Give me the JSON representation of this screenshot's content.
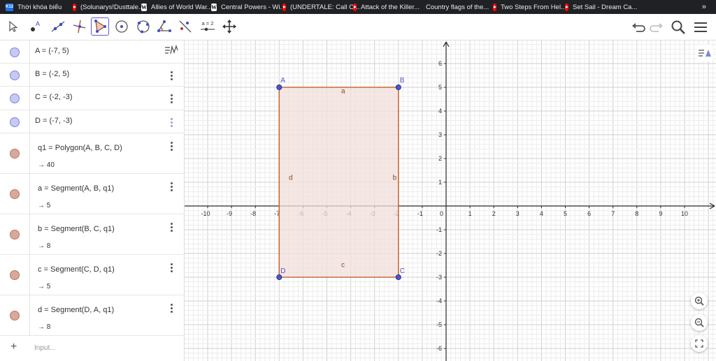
{
  "bookmarks": [
    {
      "icon": "k12",
      "label": "Thời khóa biểu"
    },
    {
      "icon": "yt",
      "label": "(Solunarys!Dusttale..."
    },
    {
      "icon": "wk",
      "label": "Allies of World War..."
    },
    {
      "icon": "wk",
      "label": "Central Powers - Wi..."
    },
    {
      "icon": "yt",
      "label": "(UNDERTALE: Call O..."
    },
    {
      "icon": "yt",
      "label": "Attack of the Killer..."
    },
    {
      "icon": "globe",
      "label": "Country flags of the..."
    },
    {
      "icon": "yt",
      "label": "Two Steps From Hel..."
    },
    {
      "icon": "yt",
      "label": "Set Sail - Dream Ca..."
    }
  ],
  "bookmarks_more": "»",
  "toolbar": {
    "slider_label": "a = 2",
    "tools": [
      "move-tool",
      "point-tool",
      "line-tool",
      "perpendicular-tool",
      "polygon-tool",
      "circle-center-tool",
      "circle-three-points-tool",
      "angle-tool",
      "reflect-tool",
      "slider-tool",
      "move-graphics-tool"
    ],
    "active_tool": "polygon-tool",
    "right": [
      "undo-icon",
      "redo-icon",
      "search-icon",
      "menu-icon"
    ]
  },
  "algebra": {
    "rows": [
      {
        "def": "A = (-7, 5)",
        "kind": "point"
      },
      {
        "def": "B = (-2, 5)",
        "kind": "point"
      },
      {
        "def": "C = (-2, -3)",
        "kind": "point"
      },
      {
        "def": "D = (-7, -3)",
        "kind": "point"
      },
      {
        "def": "q1 = Polygon(A, B, C, D)",
        "value": "→ 40",
        "kind": "segment"
      },
      {
        "def": "a = Segment(A, B, q1)",
        "value": "→ 5",
        "kind": "segment"
      },
      {
        "def": "b = Segment(B, C, q1)",
        "value": "→ 8",
        "kind": "segment"
      },
      {
        "def": "c = Segment(C, D, q1)",
        "value": "→ 5",
        "kind": "segment"
      },
      {
        "def": "d = Segment(D, A, q1)",
        "value": "→ 8",
        "kind": "segment"
      }
    ],
    "input_placeholder": "Input..."
  },
  "graph": {
    "x_ticks": [
      -10,
      -9,
      -8,
      -7,
      -6,
      -5,
      -4,
      -3,
      -2,
      -1,
      1,
      2,
      3,
      4,
      5,
      6,
      7,
      8,
      9,
      10
    ],
    "y_ticks": [
      -6,
      -5,
      -4,
      -3,
      -2,
      -1,
      1,
      2,
      3,
      4,
      5,
      6
    ],
    "origin_label": "0",
    "xlim": [
      -11.5,
      11.0
    ],
    "ylim": [
      -6.6,
      6.8
    ],
    "points": [
      {
        "name": "A",
        "x": -7,
        "y": 5
      },
      {
        "name": "B",
        "x": -2,
        "y": 5
      },
      {
        "name": "C",
        "x": -2,
        "y": -3
      },
      {
        "name": "D",
        "x": -7,
        "y": -3
      }
    ],
    "segment_labels": [
      {
        "name": "a",
        "x": -4.4,
        "y": 4.75
      },
      {
        "name": "b",
        "x": -2.24,
        "y": 1.1
      },
      {
        "name": "c",
        "x": -4.4,
        "y": -2.57
      },
      {
        "name": "d",
        "x": -6.6,
        "y": 1.1
      }
    ],
    "colors": {
      "polygon_fill": "#f2dfd9",
      "polygon_stroke": "#c66a3a",
      "point": "#4a56c8",
      "axis": "#2a2a2a",
      "grid_major": "#cfcfcf",
      "grid_minor": "#ececec",
      "tick_text": "#333333",
      "label_point": "#4a56c8",
      "label_segment": "#8a4b2b"
    }
  },
  "view_buttons": [
    "zoom-in-icon",
    "zoom-out-icon",
    "fullscreen-icon"
  ],
  "graphics_style_button": "graphics-style-icon"
}
